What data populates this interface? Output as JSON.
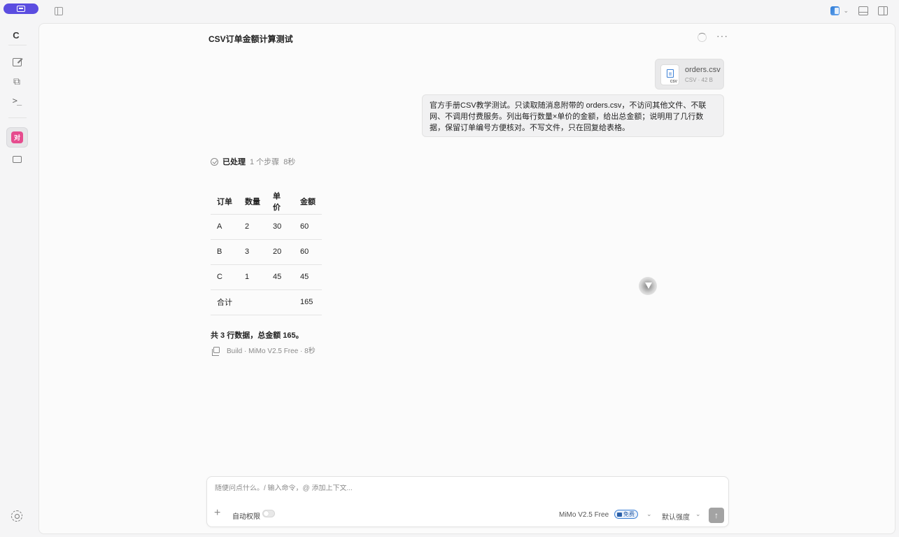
{
  "workspace": {
    "letter": "C"
  },
  "session": {
    "title": "CSV订单金额计算测试"
  },
  "attachment": {
    "name": "orders.csv",
    "meta": "CSV · 42 B",
    "ext": "CSV"
  },
  "user_message": {
    "text": "官方手册CSV教学测试。只读取随消息附带的 orders.csv，不访问其他文件、不联网、不调用付费服务。列出每行数量×单价的金额，给出总金额；说明用了几行数据，保留订单编号方便核对。不写文件，只在回复给表格。"
  },
  "processed": {
    "label": "已处理",
    "steps": "1 个步骤",
    "duration": "8秒"
  },
  "table": {
    "headers": [
      "订单",
      "数量",
      "单价",
      "金额"
    ],
    "rows": [
      [
        "A",
        "2",
        "30",
        "60"
      ],
      [
        "B",
        "3",
        "20",
        "60"
      ],
      [
        "C",
        "1",
        "45",
        "45"
      ],
      [
        "合计",
        "",
        "",
        "165"
      ]
    ]
  },
  "summary": {
    "text": "共 3 行数据，总金额 165。"
  },
  "build": {
    "text": "Build · MiMo V2.5 Free · 8秒"
  },
  "active_chat": {
    "badge": "对"
  },
  "composer": {
    "placeholder": "随便问点什么。/ 输入命令，@ 添加上下文...",
    "value": "",
    "auto_permission": "自动权限",
    "model": "MiMo V2.5 Free",
    "free_badge": "免费",
    "strength": "默认强度"
  },
  "colors": {
    "accent": "#5b4de0",
    "chat_badge": "#e64c8e",
    "free_badge": "#3a7fd5"
  }
}
